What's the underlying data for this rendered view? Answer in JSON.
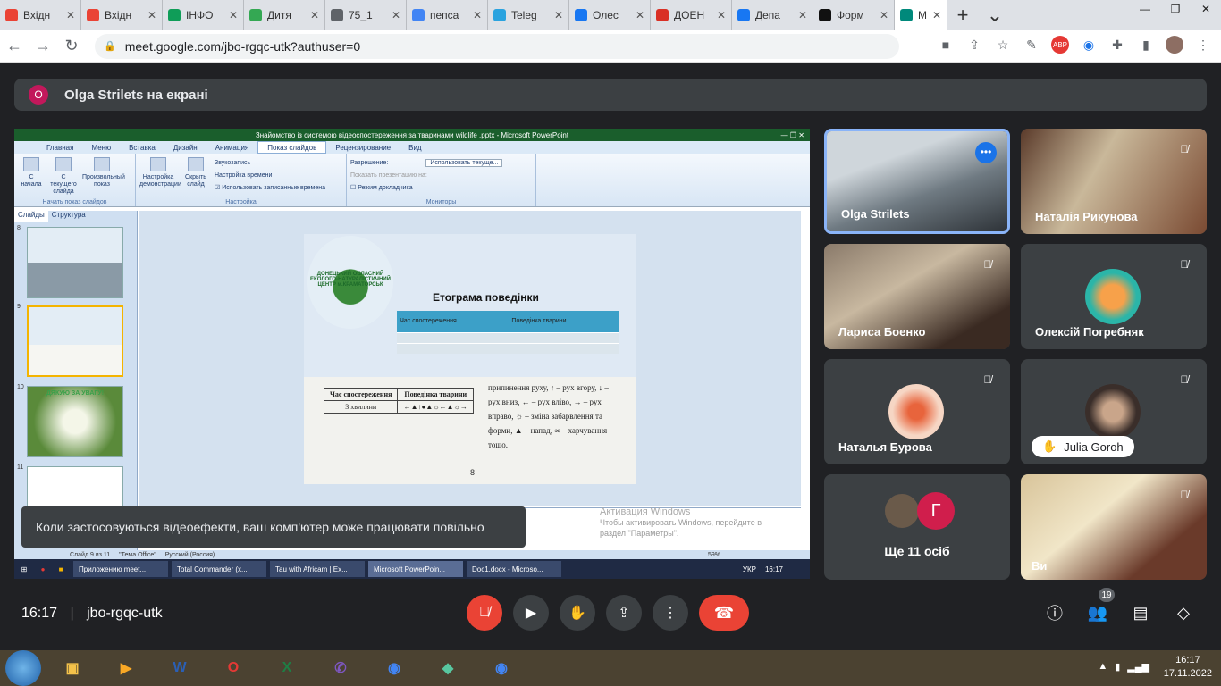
{
  "browser": {
    "tabs": [
      {
        "label": "Вхідн",
        "color": "#ea4335"
      },
      {
        "label": "Вхідн",
        "color": "#ea4335"
      },
      {
        "label": "ІНФО",
        "color": "#0f9d58"
      },
      {
        "label": "Дитя",
        "color": "#34a853"
      },
      {
        "label": "75_1",
        "color": "#5f6368"
      },
      {
        "label": "пепса",
        "color": "#4285f4"
      },
      {
        "label": "Teleg",
        "color": "#2aa3df"
      },
      {
        "label": "Олес",
        "color": "#1877f2"
      },
      {
        "label": "ДОЕН",
        "color": "#d93025"
      },
      {
        "label": "Депа",
        "color": "#1877f2"
      },
      {
        "label": "Форм",
        "color": "#111111"
      },
      {
        "label": "М",
        "color": "#00897b"
      }
    ],
    "url": "meet.google.com/jbo-rgqc-utk?authuser=0"
  },
  "meet": {
    "presenter_initial": "O",
    "presenter_banner": "Olga Strilets на екрані",
    "toast": "Коли застосовуються відеоефекти, ваш комп'ютер може працювати повільно",
    "time": "16:17",
    "meeting_code": "jbo-rgqc-utk",
    "participant_count": "19",
    "participants": [
      {
        "name": "Olga Strilets"
      },
      {
        "name": "Наталія Рикунова"
      },
      {
        "name": "Лариса Боенко"
      },
      {
        "name": "Олексій Погребняк"
      },
      {
        "name": "Наталья Бурова"
      },
      {
        "name": "Julia Goroh"
      },
      {
        "name": "Ще 11 осіб",
        "initial": "Г"
      },
      {
        "name": "Ви"
      }
    ]
  },
  "powerpoint": {
    "title": "Знайомство із системою відеоспостереження за тваринами wildlife .pptx - Microsoft PowerPoint",
    "menu": [
      "Главная",
      "Меню",
      "Вставка",
      "Дизайн",
      "Анимация",
      "Показ слайдов",
      "Рецензирование",
      "Вид"
    ],
    "ribbon": {
      "from_start": "С начала",
      "from_current": "С текущего слайда",
      "custom": "Произвольный показ",
      "group_start": "Начать показ слайдов",
      "setup_show": "Настройка демонстрации",
      "hide_slide": "Скрыть слайд",
      "record_narration": "Звукозапись",
      "rehearse": "Настройка времени",
      "use_timings": "Использовать записанные времена",
      "group_setup": "Настройка",
      "resolution_label": "Разрешение:",
      "resolution_value": "Использовать текуще...",
      "show_on": "Показать презентацию на:",
      "presenter_view": "Режим докладчика",
      "group_monitors": "Мониторы"
    },
    "pane_tabs": [
      "Слайды",
      "Структура"
    ],
    "slide_numbers": [
      "8",
      "9",
      "10",
      "11"
    ],
    "thumb10_text": "ДЯКУЮ ЗА УВАГУ!",
    "slide": {
      "logo_text": "ДОНЕЦЬКИЙ ОБЛАСНИЙ ЕКОЛОГО-НАТУРАЛІСТИЧНИЙ ЦЕНТР м.КРАМАТОРСЬК",
      "title": "Етограма поведінки",
      "col1": "Час спостереження",
      "col2": "Поведінка тварини",
      "scan_col1": "Час спостереження",
      "scan_col2": "Поведінка тварини",
      "scan_row_time": "3 хвилини",
      "scan_row_symbols": "←▲↑●▲☼←▲☼→",
      "scan_text": "припинення руху, ↑ – рух вгору, ↓ – рух вниз, ← – рух вліво, → – рух вправо, ☼ – зміна забарвлення та форми, ▲ – напад, ∞ – харчування тощо.",
      "page_number": "8"
    },
    "activation_title": "Активация Windows",
    "activation_text": "Чтобы активировать Windows, перейдите в раздел \"Параметры\".",
    "status": [
      "Слайд 9 из 11",
      "\"Тема Office\"",
      "Русский (Россия)",
      "59%"
    ],
    "taskbar": [
      "Приложению meet...",
      "Total Commander (x...",
      "Tau with Africam | Ex...",
      "Microsoft PowerPoin...",
      "Doc1.docx - Microso..."
    ],
    "tray_lang": "УКР",
    "tray_time": "16:17"
  },
  "windows": {
    "tray_time": "16:17",
    "tray_date": "17.11.2022"
  }
}
